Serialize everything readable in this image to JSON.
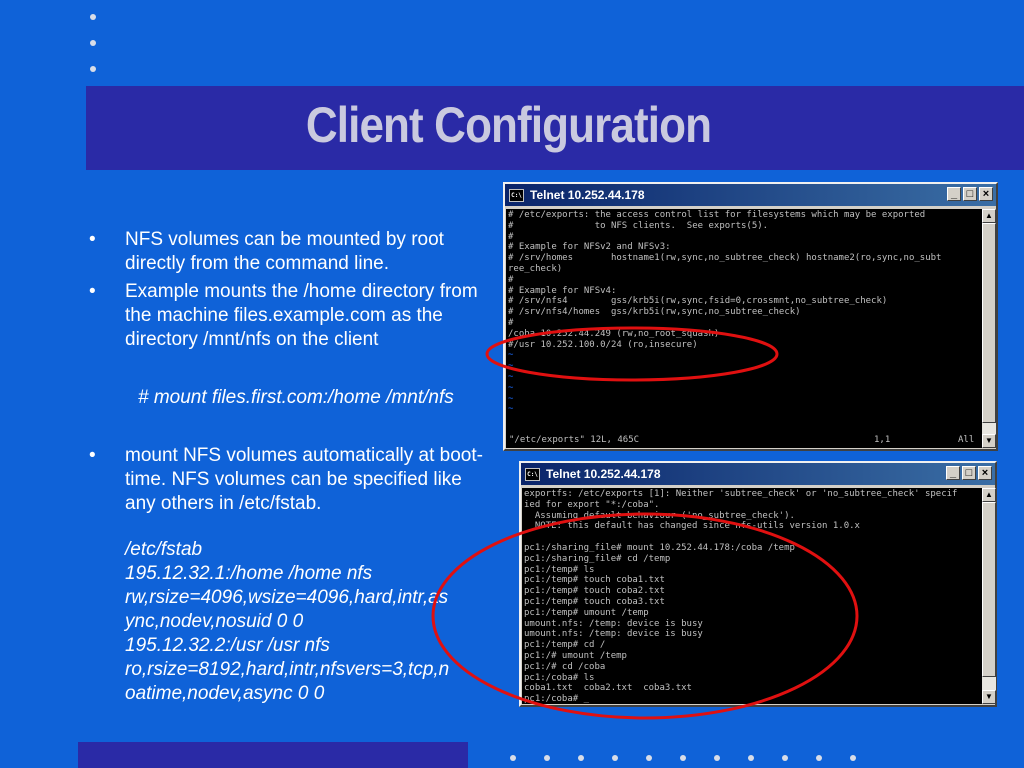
{
  "slide": {
    "title": "Client Configuration",
    "bullet_mark": "•",
    "bullets": [
      "NFS volumes can be mounted by root directly from the command line.",
      "Example mounts the /home directory from the machine files.example.com as the directory /mnt/nfs on the client"
    ],
    "command": "# mount files.first.com:/home /mnt/nfs",
    "bullet3": "mount NFS volumes automatically at boot-time. NFS volumes can be specified like any others in /etc/fstab.",
    "fstab_lines": [
      "/etc/fstab",
      "195.12.32.1:/home /home nfs",
      "rw,rsize=4096,wsize=4096,hard,intr,as",
      "ync,nodev,nosuid 0 0",
      "195.12.32.2:/usr /usr nfs",
      "ro,rsize=8192,hard,intr,nfsvers=3,tcp,n",
      "oatime,nodev,async 0 0"
    ]
  },
  "colors": {
    "background": "#0f62d8",
    "band": "#2a2aa6",
    "title": "#c9c9df",
    "circle": "#e01010"
  },
  "window1": {
    "title": "Telnet 10.252.44.178",
    "icon": "console-icon",
    "lines": [
      "# /etc/exports: the access control list for filesystems which may be exported",
      "#               to NFS clients.  See exports(5).",
      "#",
      "# Example for NFSv2 and NFSv3:",
      "# /srv/homes       hostname1(rw,sync,no_subtree_check) hostname2(ro,sync,no_subt",
      "ree_check)",
      "#",
      "# Example for NFSv4:",
      "# /srv/nfs4        gss/krb5i(rw,sync,fsid=0,crossmnt,no_subtree_check)",
      "# /srv/nfs4/homes  gss/krb5i(rw,sync,no_subtree_check)",
      "#",
      "/coba 10.252.44.249 (rw,no_root_squash)",
      "#/usr 10.252.100.0/24 (ro,insecure)",
      "~",
      "~",
      "~",
      "~",
      "~",
      "~"
    ],
    "status_left": "\"/etc/exports\" 12L, 465C",
    "status_pos": "1,1",
    "status_right": "All"
  },
  "window2": {
    "title": "Telnet 10.252.44.178",
    "lines": [
      "exportfs: /etc/exports [1]: Neither 'subtree_check' or 'no_subtree_check' specif",
      "ied for export \"*:/coba\".",
      "  Assuming default behaviour ('no_subtree_check').",
      "  NOTE: this default has changed since nfs-utils version 1.0.x",
      "",
      "pc1:/sharing_file# mount 10.252.44.178:/coba /temp",
      "pc1:/sharing_file# cd /temp",
      "pc1:/temp# ls",
      "pc1:/temp# touch coba1.txt",
      "pc1:/temp# touch coba2.txt",
      "pc1:/temp# touch coba3.txt",
      "pc1:/temp# umount /temp",
      "umount.nfs: /temp: device is busy",
      "umount.nfs: /temp: device is busy",
      "pc1:/temp# cd /",
      "pc1:/# umount /temp",
      "pc1:/# cd /coba",
      "pc1:/coba# ls",
      "coba1.txt  coba2.txt  coba3.txt",
      "pc1:/coba# _"
    ]
  },
  "window_buttons": {
    "minimize": "_",
    "maximize": "□",
    "close": "×"
  }
}
